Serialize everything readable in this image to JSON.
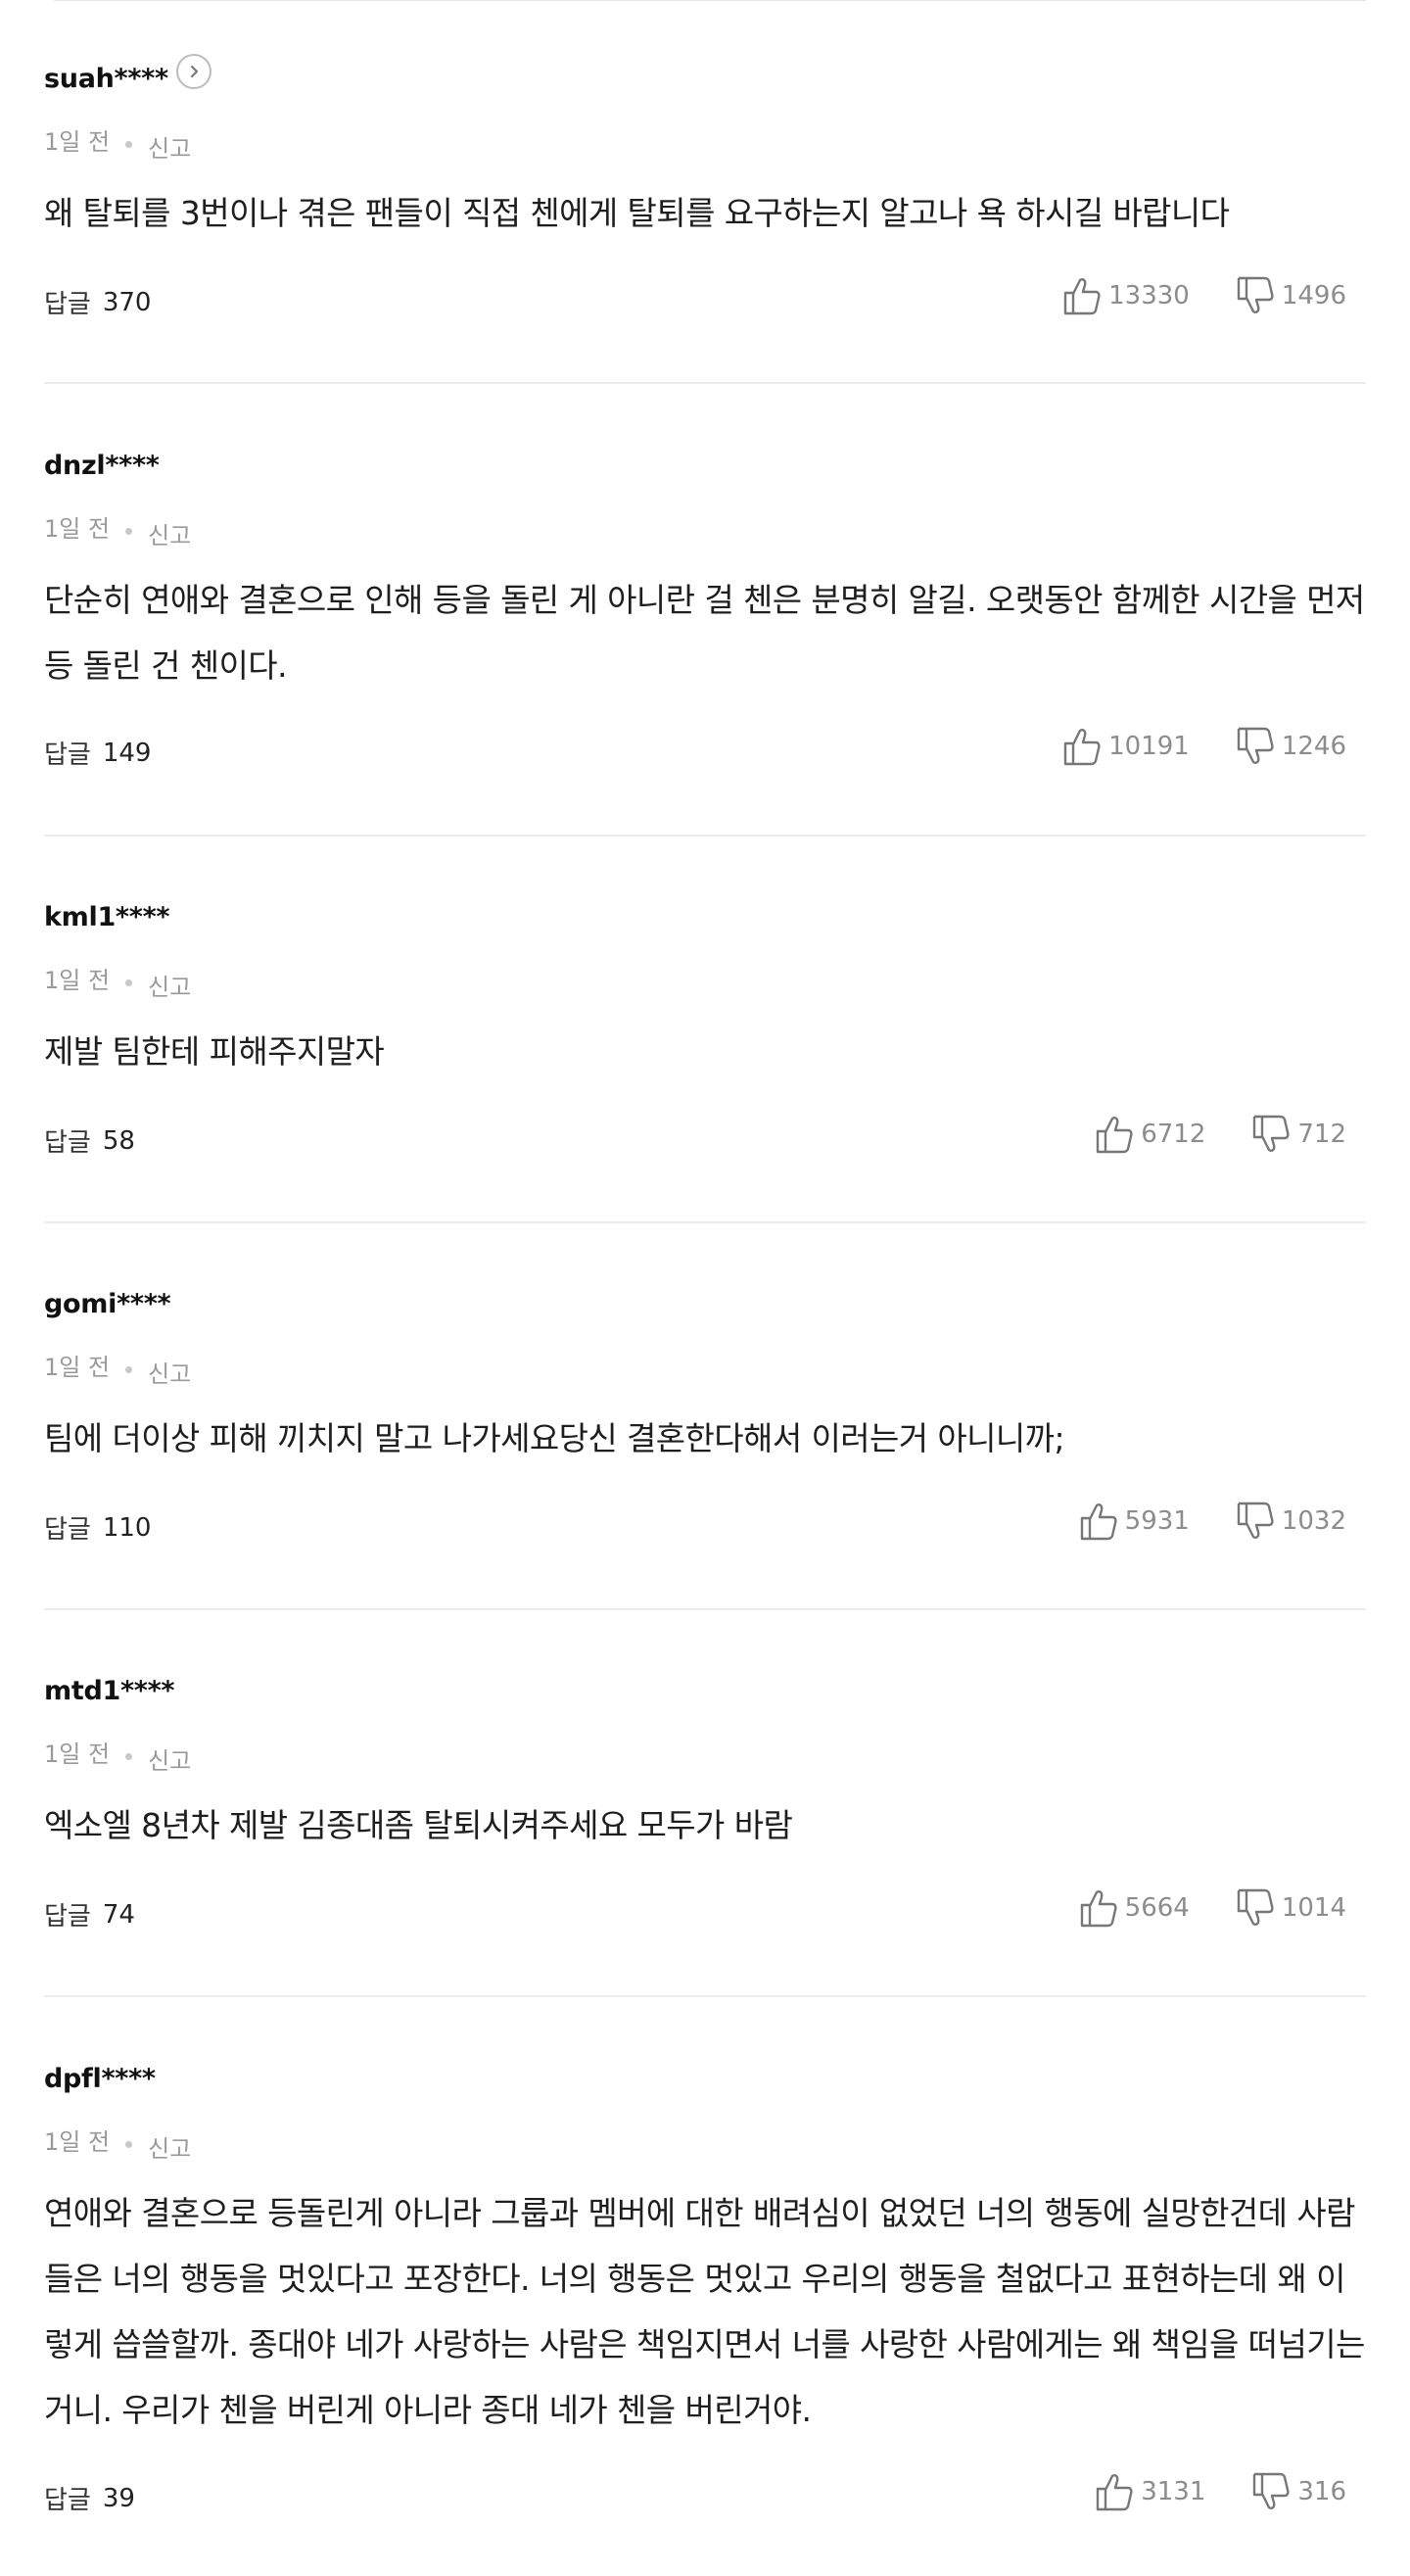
{
  "labels": {
    "reply": "답글",
    "report": "신고"
  },
  "comments": [
    {
      "author": "suah****",
      "time": "1일 전",
      "text": "왜 탈퇴를 3번이나 겪은 팬들이 직접 첸에게 탈퇴를 요구하는지 알고나 욕 하시길 바랍니다",
      "replies": "370",
      "likes": "13330",
      "dislikes": "1496"
    },
    {
      "author": "dnzl****",
      "time": "1일 전",
      "text": "단순히 연애와 결혼으로 인해 등을 돌린 게 아니란 걸 첸은 분명히 알길. 오랫동안 함께한 시간을 먼저 등 돌린 건 첸이다.",
      "replies": "149",
      "likes": "10191",
      "dislikes": "1246"
    },
    {
      "author": "kml1****",
      "time": "1일 전",
      "text": "제발 팀한테 피해주지말자",
      "replies": "58",
      "likes": "6712",
      "dislikes": "712"
    },
    {
      "author": "gomi****",
      "time": "1일 전",
      "text": "팀에 더이상 피해 끼치지 말고 나가세요당신 결혼한다해서 이러는거 아니니까;",
      "replies": "110",
      "likes": "5931",
      "dislikes": "1032"
    },
    {
      "author": "mtd1****",
      "time": "1일 전",
      "text": "엑소엘 8년차 제발 김종대좀 탈퇴시켜주세요 모두가 바람",
      "replies": "74",
      "likes": "5664",
      "dislikes": "1014"
    },
    {
      "author": "dpfl****",
      "time": "1일 전",
      "text": "연애와 결혼으로 등돌린게 아니라 그룹과 멤버에 대한 배려심이 없었던 너의 행동에 실망한건데 사람들은 너의 행동을 멋있다고 포장한다. 너의 행동은 멋있고 우리의 행동을 철없다고 표현하는데 왜 이렇게 씁쓸할까. 종대야 네가 사랑하는 사람은 책임지면서 너를 사랑한 사람에게는 왜 책임을 떠넘기는 거니. 우리가 첸을 버린게 아니라 종대 네가 첸을 버린거야.",
      "replies": "39",
      "likes": "3131",
      "dislikes": "316"
    }
  ],
  "icons": {
    "profile": "chevron-right-icon",
    "like": "thumbs-up-icon",
    "dislike": "thumbs-down-icon"
  }
}
